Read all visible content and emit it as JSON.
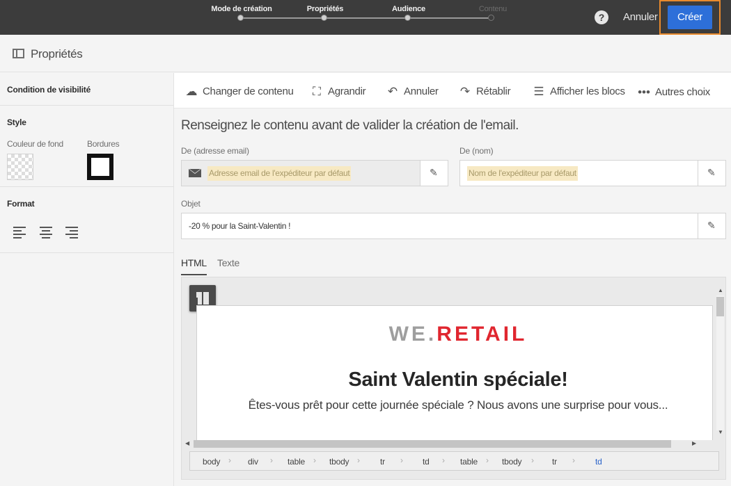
{
  "wizard": {
    "steps": [
      {
        "label": "Mode de création",
        "state": "done"
      },
      {
        "label": "Propriétés",
        "state": "current"
      },
      {
        "label": "Audience",
        "state": "done"
      },
      {
        "label": "Contenu",
        "state": "pending"
      }
    ],
    "help_icon": "?",
    "cancel_label": "Annuler",
    "create_label": "Créer"
  },
  "header": {
    "title": "Propriétés",
    "icon": "panel-icon"
  },
  "sidebar": {
    "visibility_label": "Condition de visibilité",
    "style_label": "Style",
    "background_color_label": "Couleur de fond",
    "borders_label": "Bordures",
    "format_label": "Format",
    "align_options": [
      "align-left",
      "align-center",
      "align-right"
    ]
  },
  "toolbar": {
    "items": [
      {
        "label": "Changer de contenu",
        "icon": "cloud-upload-icon"
      },
      {
        "label": "Agrandir",
        "icon": "expand-icon"
      },
      {
        "label": "Annuler",
        "icon": "undo-icon"
      },
      {
        "label": "Rétablir",
        "icon": "redo-icon"
      },
      {
        "label": "Afficher les blocs",
        "icon": "list-icon"
      },
      {
        "label": "Autres choix",
        "icon": "more-icon"
      }
    ]
  },
  "form": {
    "intro": "Renseignez le contenu avant de valider la création de l'email.",
    "from_email": {
      "label": "De (adresse email)",
      "placeholder": "Adresse email de l'expéditeur par défaut"
    },
    "from_name": {
      "label": "De (nom)",
      "placeholder": "Nom de l'expéditeur par défaut"
    },
    "subject": {
      "label": "Objet",
      "value": "-20 % pour la Saint-Valentin !"
    }
  },
  "tabs": [
    {
      "label": "HTML",
      "active": true
    },
    {
      "label": "Texte",
      "active": false
    }
  ],
  "preview": {
    "logo_we": "WE.",
    "logo_retail": "RETAIL",
    "heading": "Saint Valentin spéciale!",
    "paragraph": "Êtes-vous prêt pour cette journée spéciale ? Nous avons une surprise pour vous...",
    "breadcrumb": [
      "body",
      "div",
      "table",
      "tbody",
      "tr",
      "td",
      "table",
      "tbody",
      "tr",
      "td"
    ]
  },
  "colors": {
    "topbar": "#3c3c3c",
    "accent": "#2d6fd9",
    "highlight": "#e98a2d",
    "brand_red": "#e0262f"
  }
}
